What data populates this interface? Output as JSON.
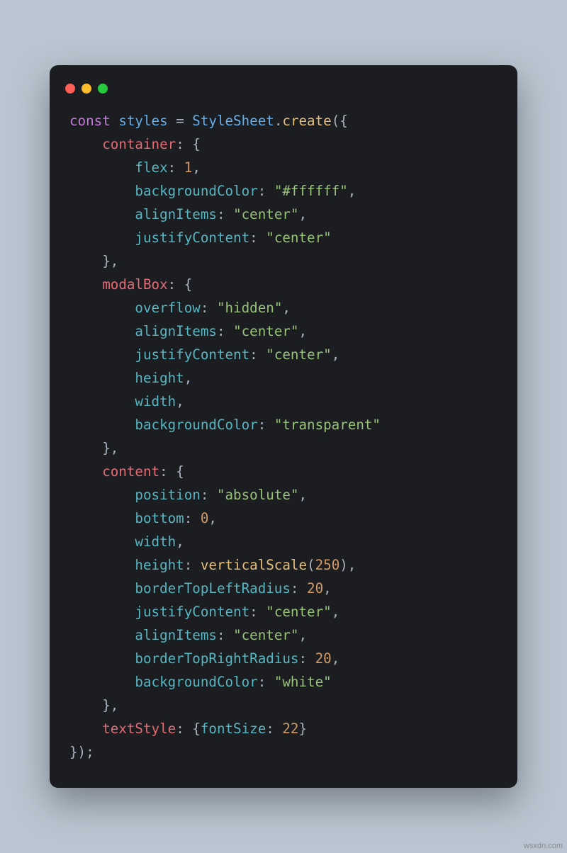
{
  "window": {
    "buttons": [
      "close",
      "minimize",
      "zoom"
    ]
  },
  "code": {
    "lines": [
      [
        {
          "t": "const ",
          "c": "tok-kw"
        },
        {
          "t": "styles ",
          "c": "tok-var"
        },
        {
          "t": "= ",
          "c": "tok-punc"
        },
        {
          "t": "StyleSheet",
          "c": "tok-var"
        },
        {
          "t": ".",
          "c": "tok-punc"
        },
        {
          "t": "create",
          "c": "tok-fn"
        },
        {
          "t": "({",
          "c": "tok-punc"
        }
      ],
      [
        {
          "t": "    ",
          "c": "tok-punc"
        },
        {
          "t": "container",
          "c": "tok-field"
        },
        {
          "t": ": {",
          "c": "tok-punc"
        }
      ],
      [
        {
          "t": "        ",
          "c": "tok-punc"
        },
        {
          "t": "flex",
          "c": "tok-prop"
        },
        {
          "t": ": ",
          "c": "tok-punc"
        },
        {
          "t": "1",
          "c": "tok-num"
        },
        {
          "t": ",",
          "c": "tok-punc"
        }
      ],
      [
        {
          "t": "        ",
          "c": "tok-punc"
        },
        {
          "t": "backgroundColor",
          "c": "tok-prop"
        },
        {
          "t": ": ",
          "c": "tok-punc"
        },
        {
          "t": "\"#ffffff\"",
          "c": "tok-str"
        },
        {
          "t": ",",
          "c": "tok-punc"
        }
      ],
      [
        {
          "t": "        ",
          "c": "tok-punc"
        },
        {
          "t": "alignItems",
          "c": "tok-prop"
        },
        {
          "t": ": ",
          "c": "tok-punc"
        },
        {
          "t": "\"center\"",
          "c": "tok-str"
        },
        {
          "t": ",",
          "c": "tok-punc"
        }
      ],
      [
        {
          "t": "        ",
          "c": "tok-punc"
        },
        {
          "t": "justifyContent",
          "c": "tok-prop"
        },
        {
          "t": ": ",
          "c": "tok-punc"
        },
        {
          "t": "\"center\"",
          "c": "tok-str"
        }
      ],
      [
        {
          "t": "    },",
          "c": "tok-punc"
        }
      ],
      [
        {
          "t": "    ",
          "c": "tok-punc"
        },
        {
          "t": "modalBox",
          "c": "tok-field"
        },
        {
          "t": ": {",
          "c": "tok-punc"
        }
      ],
      [
        {
          "t": "        ",
          "c": "tok-punc"
        },
        {
          "t": "overflow",
          "c": "tok-prop"
        },
        {
          "t": ": ",
          "c": "tok-punc"
        },
        {
          "t": "\"hidden\"",
          "c": "tok-str"
        },
        {
          "t": ",",
          "c": "tok-punc"
        }
      ],
      [
        {
          "t": "        ",
          "c": "tok-punc"
        },
        {
          "t": "alignItems",
          "c": "tok-prop"
        },
        {
          "t": ": ",
          "c": "tok-punc"
        },
        {
          "t": "\"center\"",
          "c": "tok-str"
        },
        {
          "t": ",",
          "c": "tok-punc"
        }
      ],
      [
        {
          "t": "        ",
          "c": "tok-punc"
        },
        {
          "t": "justifyContent",
          "c": "tok-prop"
        },
        {
          "t": ": ",
          "c": "tok-punc"
        },
        {
          "t": "\"center\"",
          "c": "tok-str"
        },
        {
          "t": ",",
          "c": "tok-punc"
        }
      ],
      [
        {
          "t": "        ",
          "c": "tok-punc"
        },
        {
          "t": "height",
          "c": "tok-prop"
        },
        {
          "t": ",",
          "c": "tok-punc"
        }
      ],
      [
        {
          "t": "        ",
          "c": "tok-punc"
        },
        {
          "t": "width",
          "c": "tok-prop"
        },
        {
          "t": ",",
          "c": "tok-punc"
        }
      ],
      [
        {
          "t": "        ",
          "c": "tok-punc"
        },
        {
          "t": "backgroundColor",
          "c": "tok-prop"
        },
        {
          "t": ": ",
          "c": "tok-punc"
        },
        {
          "t": "\"transparent\"",
          "c": "tok-str"
        }
      ],
      [
        {
          "t": "    },",
          "c": "tok-punc"
        }
      ],
      [
        {
          "t": "    ",
          "c": "tok-punc"
        },
        {
          "t": "content",
          "c": "tok-field"
        },
        {
          "t": ": {",
          "c": "tok-punc"
        }
      ],
      [
        {
          "t": "        ",
          "c": "tok-punc"
        },
        {
          "t": "position",
          "c": "tok-prop"
        },
        {
          "t": ": ",
          "c": "tok-punc"
        },
        {
          "t": "\"absolute\"",
          "c": "tok-str"
        },
        {
          "t": ",",
          "c": "tok-punc"
        }
      ],
      [
        {
          "t": "        ",
          "c": "tok-punc"
        },
        {
          "t": "bottom",
          "c": "tok-prop"
        },
        {
          "t": ": ",
          "c": "tok-punc"
        },
        {
          "t": "0",
          "c": "tok-num"
        },
        {
          "t": ",",
          "c": "tok-punc"
        }
      ],
      [
        {
          "t": "        ",
          "c": "tok-punc"
        },
        {
          "t": "width",
          "c": "tok-prop"
        },
        {
          "t": ",",
          "c": "tok-punc"
        }
      ],
      [
        {
          "t": "        ",
          "c": "tok-punc"
        },
        {
          "t": "height",
          "c": "tok-prop"
        },
        {
          "t": ": ",
          "c": "tok-punc"
        },
        {
          "t": "verticalScale",
          "c": "tok-fn"
        },
        {
          "t": "(",
          "c": "tok-punc"
        },
        {
          "t": "250",
          "c": "tok-num"
        },
        {
          "t": "),",
          "c": "tok-punc"
        }
      ],
      [
        {
          "t": "        ",
          "c": "tok-punc"
        },
        {
          "t": "borderTopLeftRadius",
          "c": "tok-prop"
        },
        {
          "t": ": ",
          "c": "tok-punc"
        },
        {
          "t": "20",
          "c": "tok-num"
        },
        {
          "t": ",",
          "c": "tok-punc"
        }
      ],
      [
        {
          "t": "        ",
          "c": "tok-punc"
        },
        {
          "t": "justifyContent",
          "c": "tok-prop"
        },
        {
          "t": ": ",
          "c": "tok-punc"
        },
        {
          "t": "\"center\"",
          "c": "tok-str"
        },
        {
          "t": ",",
          "c": "tok-punc"
        }
      ],
      [
        {
          "t": "        ",
          "c": "tok-punc"
        },
        {
          "t": "alignItems",
          "c": "tok-prop"
        },
        {
          "t": ": ",
          "c": "tok-punc"
        },
        {
          "t": "\"center\"",
          "c": "tok-str"
        },
        {
          "t": ",",
          "c": "tok-punc"
        }
      ],
      [
        {
          "t": "        ",
          "c": "tok-punc"
        },
        {
          "t": "borderTopRightRadius",
          "c": "tok-prop"
        },
        {
          "t": ": ",
          "c": "tok-punc"
        },
        {
          "t": "20",
          "c": "tok-num"
        },
        {
          "t": ",",
          "c": "tok-punc"
        }
      ],
      [
        {
          "t": "        ",
          "c": "tok-punc"
        },
        {
          "t": "backgroundColor",
          "c": "tok-prop"
        },
        {
          "t": ": ",
          "c": "tok-punc"
        },
        {
          "t": "\"white\"",
          "c": "tok-str"
        }
      ],
      [
        {
          "t": "    },",
          "c": "tok-punc"
        }
      ],
      [
        {
          "t": "    ",
          "c": "tok-punc"
        },
        {
          "t": "textStyle",
          "c": "tok-field"
        },
        {
          "t": ": {",
          "c": "tok-punc"
        },
        {
          "t": "fontSize",
          "c": "tok-prop"
        },
        {
          "t": ": ",
          "c": "tok-punc"
        },
        {
          "t": "22",
          "c": "tok-num"
        },
        {
          "t": "}",
          "c": "tok-punc"
        }
      ],
      [
        {
          "t": "});",
          "c": "tok-punc"
        }
      ]
    ]
  },
  "watermark": "wsxdn.com"
}
